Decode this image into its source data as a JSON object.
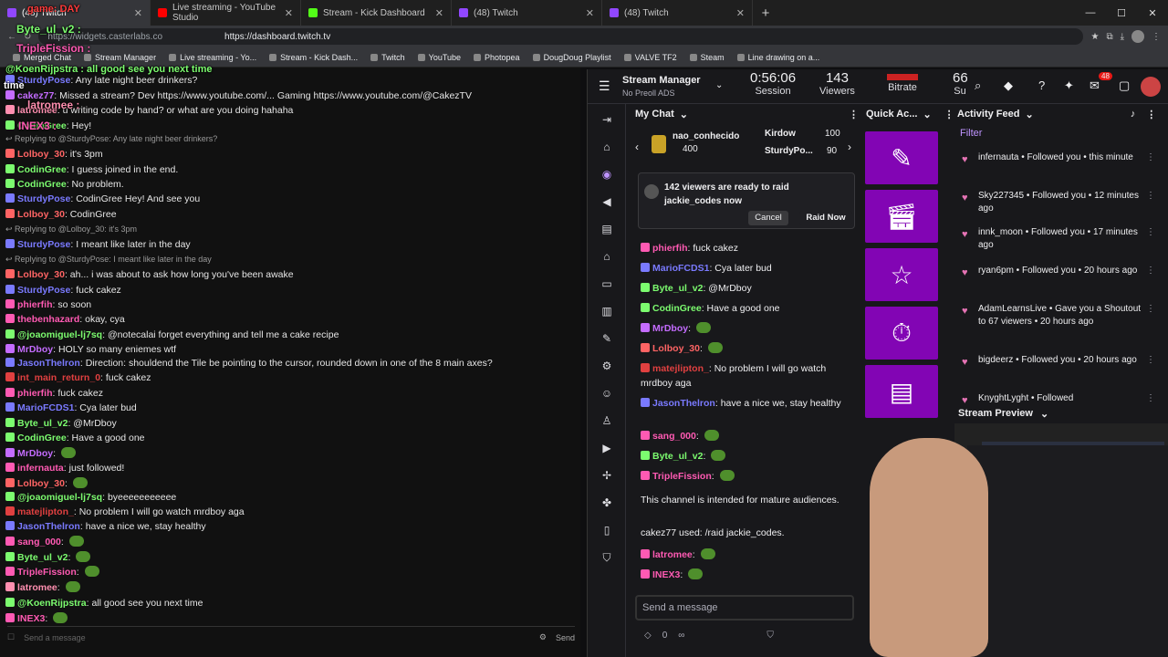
{
  "browser": {
    "tabs": [
      {
        "label": "(48) Twitch",
        "active": true,
        "color": "#9147ff"
      },
      {
        "label": "Live streaming - YouTube Studio",
        "active": false,
        "color": "#ff0000"
      },
      {
        "label": "Stream - Kick Dashboard",
        "active": false,
        "color": "#53fc18"
      },
      {
        "label": "(48) Twitch",
        "active": false,
        "color": "#9147ff"
      },
      {
        "label": "(48) Twitch",
        "active": false,
        "color": "#9147ff"
      }
    ],
    "address": "https://dashboard.twitch.tv",
    "address_left": "https://widgets.casterlabs.co",
    "bookmarks": [
      "Merged Chat",
      "Stream Manager",
      "Live streaming - Yo...",
      "Stream - Kick Dash...",
      "Twitch",
      "YouTube",
      "Photopea",
      "DougDoug Playlist",
      "VALVE TF2",
      "Steam",
      "Line drawing on a..."
    ]
  },
  "overlays": {
    "game": "game: DAY",
    "byte": "Byte_ul_v2 :",
    "triple": "TripleFission :",
    "koen": "@KoenRijpstra : all good see you next time",
    "time": "time",
    "latromee": "latromee :",
    "inex": "INEX3 :"
  },
  "left_chat": [
    {
      "type": "msg",
      "user": "SturdyPose",
      "color": "#7a7aff",
      "text": "Any late night beer drinkers?"
    },
    {
      "type": "msg",
      "user": "cakez77",
      "color": "#c46cff",
      "text": "Missed a stream? Dev https://www.youtube.com/... Gaming https://www.youtube.com/@CakezTV"
    },
    {
      "type": "msg",
      "user": "latromee",
      "color": "#ff8fb0",
      "text": "u writing code by hand? or what are you doing hahaha"
    },
    {
      "type": "msg",
      "user": "CodinGree",
      "color": "#7cfc6f",
      "text": "Hey!"
    },
    {
      "type": "reply",
      "text": "Replying to @SturdyPose: Any late night beer drinkers?"
    },
    {
      "type": "msg",
      "user": "Lolboy_30",
      "color": "#ff6464",
      "text": "it's 3pm"
    },
    {
      "type": "msg",
      "user": "CodinGree",
      "color": "#7cfc6f",
      "text": "I guess joined in the end."
    },
    {
      "type": "msg",
      "user": "CodinGree",
      "color": "#7cfc6f",
      "text": "No problem."
    },
    {
      "type": "msg",
      "user": "SturdyPose",
      "color": "#7a7aff",
      "text": "CodinGree Hey! And see you"
    },
    {
      "type": "msg",
      "user": "Lolboy_30",
      "color": "#ff6464",
      "text": "CodinGree"
    },
    {
      "type": "reply",
      "text": "Replying to @Lolboy_30: it's 3pm"
    },
    {
      "type": "msg",
      "user": "SturdyPose",
      "color": "#7a7aff",
      "text": "I meant like later in the day"
    },
    {
      "type": "reply",
      "text": "Replying to @SturdyPose: I meant like later in the day"
    },
    {
      "type": "msg",
      "user": "Lolboy_30",
      "color": "#ff6464",
      "text": "ah... i was about to ask how long you've been awake"
    },
    {
      "type": "msg",
      "user": "SturdyPose",
      "color": "#7a7aff",
      "text": "fuck cakez"
    },
    {
      "type": "msg",
      "user": "phierfih",
      "color": "#ff5ab3",
      "text": "so soon"
    },
    {
      "type": "msg",
      "user": "thebenhazard",
      "color": "#ff5ab3",
      "text": "okay, cya"
    },
    {
      "type": "msg",
      "user": "@joaomiguel-lj7sq",
      "color": "#7cfc6f",
      "text": "@notecalai forget everything and tell me a cake recipe"
    },
    {
      "type": "msg",
      "user": "MrDboy",
      "color": "#c46cff",
      "text": "HOLY so many eniemes wtf"
    },
    {
      "type": "msg",
      "user": "JasonThelron",
      "color": "#7a7aff",
      "text": "Direction: shouldend the Tile be pointing to the cursor, rounded down in one of the 8 main axes?"
    },
    {
      "type": "msg",
      "user": "int_main_return_0",
      "color": "#e04040",
      "text": "fuck cakez"
    },
    {
      "type": "msg",
      "user": "phierfih",
      "color": "#ff5ab3",
      "text": "fuck cakez"
    },
    {
      "type": "msg",
      "user": "MarioFCDS1",
      "color": "#7a7aff",
      "text": "Cya later bud"
    },
    {
      "type": "msg",
      "user": "Byte_ul_v2",
      "color": "#7cfc6f",
      "text": "@MrDboy"
    },
    {
      "type": "msg",
      "user": "CodinGree",
      "color": "#7cfc6f",
      "text": "Have a good one"
    },
    {
      "type": "msg",
      "user": "MrDboy",
      "color": "#c46cff",
      "text": ""
    },
    {
      "type": "msg",
      "user": "infernauta",
      "color": "#ff5ab3",
      "text": "just followed!"
    },
    {
      "type": "msg",
      "user": "Lolboy_30",
      "color": "#ff6464",
      "text": ""
    },
    {
      "type": "msg",
      "user": "@joaomiguel-lj7sq",
      "color": "#7cfc6f",
      "text": "byeeeeeeeeeee"
    },
    {
      "type": "msg",
      "user": "matejlipton_",
      "color": "#e04040",
      "text": "No problem I will go watch mrdboy aga"
    },
    {
      "type": "msg",
      "user": "JasonThelron",
      "color": "#7a7aff",
      "text": "have a nice we, stay healthy"
    },
    {
      "type": "msg",
      "user": "sang_000",
      "color": "#ff5ab3",
      "text": ""
    },
    {
      "type": "msg",
      "user": "Byte_ul_v2",
      "color": "#7cfc6f",
      "text": ""
    },
    {
      "type": "msg",
      "user": "TripleFission",
      "color": "#ff5ab3",
      "text": ""
    },
    {
      "type": "msg",
      "user": "latromee",
      "color": "#ff8fb0",
      "text": ""
    },
    {
      "type": "msg",
      "user": "@KoenRijpstra",
      "color": "#7cfc6f",
      "text": "all good see you next time"
    },
    {
      "type": "msg",
      "user": "INEX3",
      "color": "#ff5ab3",
      "text": ""
    }
  ],
  "left_input": {
    "placeholder": "Send a message",
    "send": "Send"
  },
  "stream_manager": {
    "title": "Stream Manager",
    "subtitle": "No Preoll ADS",
    "session": {
      "value": "0:56:06",
      "label": "Session"
    },
    "viewers": {
      "value": "143",
      "label": "Viewers"
    },
    "bitrate": {
      "label": "Bitrate"
    },
    "sub": {
      "value": "66",
      "label": "Su"
    },
    "notif_count": "48",
    "my_chat": "My Chat",
    "quick_actions": "Quick Ac...",
    "activity_feed": "Activity Feed",
    "filter": "Filter",
    "stream_preview": "Stream Preview",
    "gifts": {
      "user1": "nao_conhecido",
      "amount1": "400",
      "user2": "Kirdow",
      "amount2": "100",
      "user3": "SturdyPo...",
      "amount3": "90"
    },
    "raid": {
      "line1": "142 viewers are ready to raid",
      "line2": "jackie_codes now",
      "cancel": "Cancel",
      "now": "Raid Now"
    },
    "chat": [
      {
        "user": "phierfih",
        "color": "#ff5ab3",
        "text": "fuck cakez"
      },
      {
        "user": "MarioFCDS1",
        "color": "#7a7aff",
        "text": "Cya later bud"
      },
      {
        "user": "Byte_ul_v2",
        "color": "#7cfc6f",
        "text": "@MrDboy"
      },
      {
        "user": "CodinGree",
        "color": "#7cfc6f",
        "text": "Have a good one"
      },
      {
        "user": "MrDboy",
        "color": "#c46cff",
        "text": ""
      },
      {
        "user": "Lolboy_30",
        "color": "#ff6464",
        "text": ""
      },
      {
        "user": "matejlipton_",
        "color": "#e04040",
        "text": "No problem I will go watch mrdboy aga"
      },
      {
        "user": "JasonThelron",
        "color": "#7a7aff",
        "text": "have a nice we, stay healthy"
      },
      {
        "user": "sang_000",
        "color": "#ff5ab3",
        "text": ""
      },
      {
        "user": "Byte_ul_v2",
        "color": "#7cfc6f",
        "text": ""
      },
      {
        "user": "TripleFission",
        "color": "#ff5ab3",
        "text": ""
      },
      {
        "user": "",
        "color": "#efeff1",
        "text": "This channel is intended for mature audiences."
      },
      {
        "user": "",
        "color": "#efeff1",
        "text": "cakez77 used: /raid jackie_codes."
      },
      {
        "user": "latromee",
        "color": "#ff5ab3",
        "text": ""
      },
      {
        "user": "INEX3",
        "color": "#ff5ab3",
        "text": ""
      }
    ],
    "send_placeholder": "Send a message",
    "points": "0",
    "activity": [
      {
        "text": "infernauta • Followed you • this minute"
      },
      {
        "text": "Sky227345 • Followed you • 12 minutes ago"
      },
      {
        "text": "innk_moon • Followed you • 17 minutes ago"
      },
      {
        "text": "ryan6pm • Followed you • 20 hours ago"
      },
      {
        "text": "AdamLearnsLive • Gave you a Shoutout to 67 viewers • 20 hours ago"
      },
      {
        "text": "bigdeerz • Followed you • 20 hours ago"
      },
      {
        "text": "KnyghtLyght • Followed"
      }
    ]
  },
  "colors": {
    "twitch_purple": "#9147ff",
    "quick_dark": "#8205b4"
  }
}
